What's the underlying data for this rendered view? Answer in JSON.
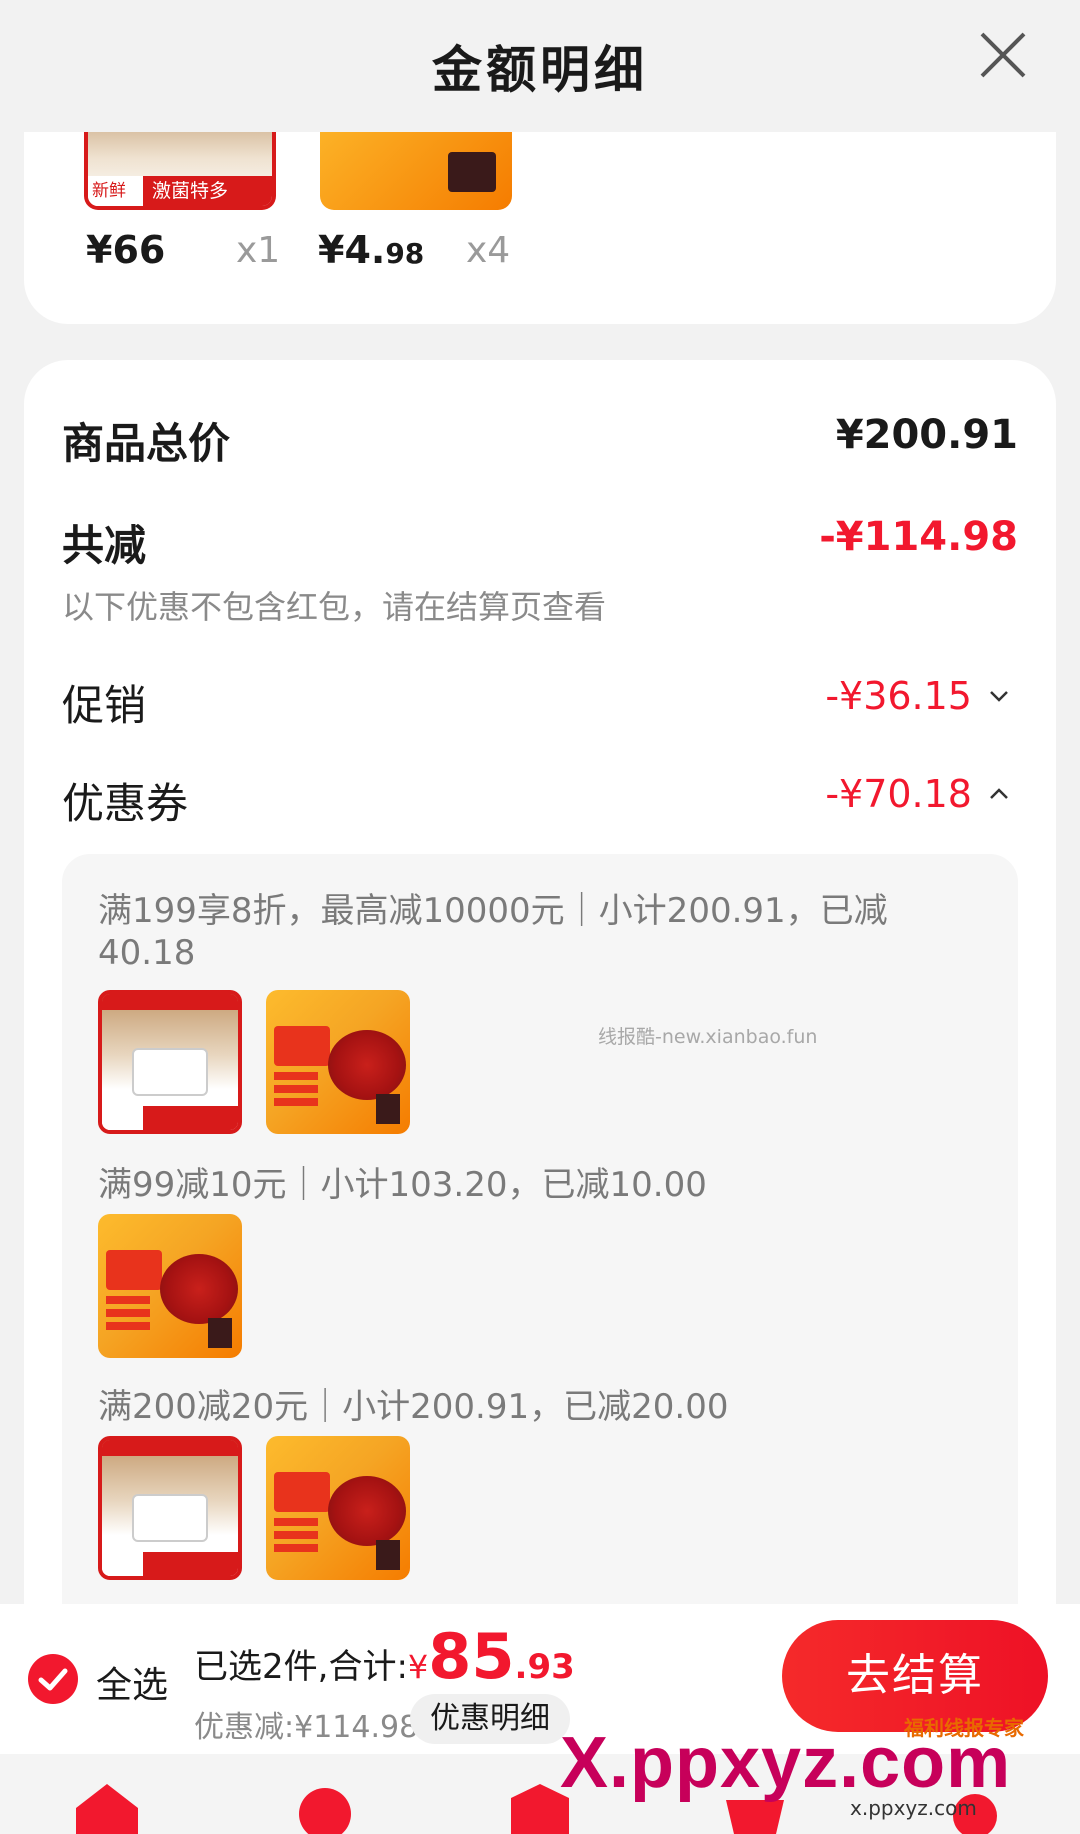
{
  "header": {
    "title": "金额明细"
  },
  "products": [
    {
      "price_main": "¥66",
      "price_dec": "",
      "qty": "x1",
      "thumb_text": "激菌特多",
      "thumb_badge": "新鲜"
    },
    {
      "price_main": "¥4.",
      "price_dec": "98",
      "qty": "x4"
    }
  ],
  "summary": {
    "total_label": "商品总价",
    "total_value": "¥200.91",
    "reduce_label": "共减",
    "reduce_value": "-¥114.98",
    "reduce_note": "以下优惠不包含红包，请在结算页查看",
    "promo_label": "促销",
    "promo_value": "-¥36.15",
    "coupon_label": "优惠券",
    "coupon_value": "-¥70.18"
  },
  "coupons": [
    {
      "text": "满199享8折，最高减10000元｜小计200.91，已减40.18"
    },
    {
      "text": "满99减10元｜小计103.20，已减10.00"
    },
    {
      "text": "满200减20元｜小计200.91，已减20.00"
    }
  ],
  "watermark": "线报酷-new.xianbao.fun",
  "checkout": {
    "select_all": "全选",
    "selected_prefix": "已选2件,合计:",
    "currency": "¥",
    "total_int": "85",
    "total_dec": ".93",
    "savings": "优惠减:¥114.98",
    "detail_button": "优惠明细",
    "checkout_button": "去结算"
  },
  "branding": {
    "main": "X.ppxyz.com",
    "sub": "x.ppxyz.com",
    "tag": "福利线报专家"
  },
  "colors": {
    "accent": "#f2182e",
    "background": "#f2f2f2"
  }
}
